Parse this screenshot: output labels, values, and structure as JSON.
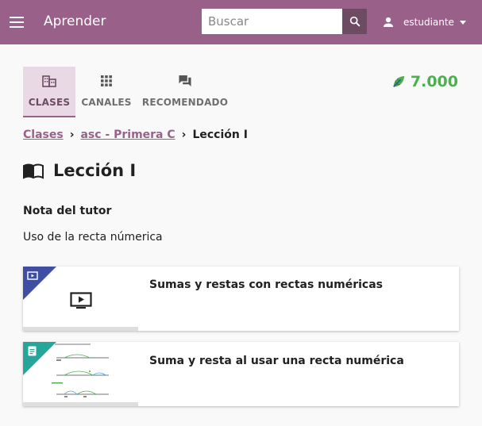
{
  "header": {
    "app_title": "Aprender",
    "search_placeholder": "Buscar",
    "user_name": "estudiante"
  },
  "nav": {
    "tabs": [
      {
        "label": "CLASES",
        "active": true,
        "icon": "classroom-icon"
      },
      {
        "label": "CANALES",
        "active": false,
        "icon": "grid-icon"
      },
      {
        "label": "RECOMENDADO",
        "active": false,
        "icon": "forum-icon"
      }
    ]
  },
  "points": {
    "value": "7.000",
    "icon": "leaf-icon",
    "color": "#4caf50"
  },
  "breadcrumb": {
    "items": [
      "Clases",
      "asc - Primera C"
    ],
    "current": "Lección I"
  },
  "lesson": {
    "title": "Lección I",
    "note_label": "Nota del tutor",
    "note_text": "Uso de la recta númerica"
  },
  "cards": [
    {
      "title": "Sumas y restas con rectas numéricas",
      "kind": "video",
      "progress": 0
    },
    {
      "title": "Suma y resta al usar una recta numérica",
      "kind": "exercise",
      "progress": 0
    }
  ],
  "colors": {
    "brand": "#996189",
    "video": "#3f4ea3",
    "exercise": "#26a69a"
  }
}
